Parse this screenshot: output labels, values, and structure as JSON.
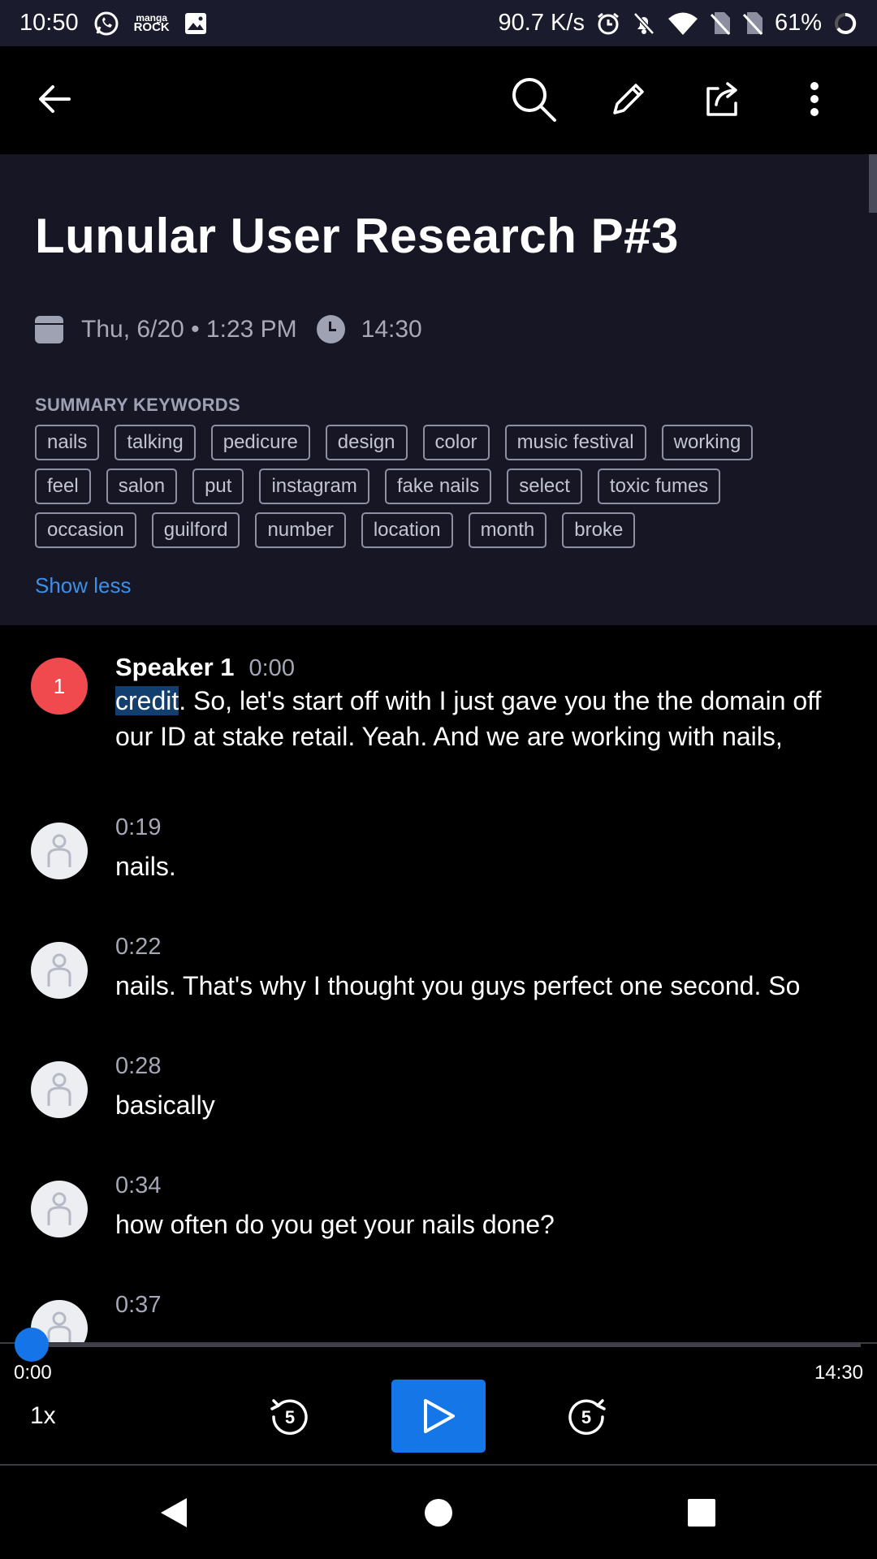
{
  "status_bar": {
    "time": "10:50",
    "app_label_top": "manga",
    "app_label_bottom": "ROCK",
    "net_speed": "90.7 K/s",
    "battery": "61%",
    "icons": [
      "whatsapp-icon",
      "manga-rock-icon",
      "image-icon",
      "alarm-icon",
      "bell-off-icon",
      "wifi-icon",
      "no-sim-icon",
      "no-sim-icon",
      "battery-icon"
    ]
  },
  "app_bar": {
    "icons": [
      "back-arrow-icon",
      "search-icon",
      "edit-pencil-icon",
      "share-icon",
      "more-vert-icon"
    ]
  },
  "header": {
    "title": "Lunular User Research P#3",
    "date": "Thu, 6/20 • 1:23 PM",
    "duration": "14:30",
    "keywords_label": "SUMMARY KEYWORDS",
    "keyword_rows": [
      [
        "nails",
        "talking",
        "pedicure",
        "design",
        "color",
        "music festival",
        "working"
      ],
      [
        "feel",
        "salon",
        "put",
        "instagram",
        "fake nails",
        "select",
        "toxic fumes"
      ],
      [
        "occasion",
        "guilford",
        "number",
        "location",
        "month",
        "broke"
      ]
    ],
    "show_less": "Show less"
  },
  "transcript": {
    "first": {
      "speaker_badge": "1",
      "speaker": "Speaker 1",
      "time": "0:00",
      "highlighted_word": "credit",
      "text_rest": ". So, let's start off with I just gave you the the domain off our ID at stake retail. Yeah. And we are working with nails,"
    },
    "entries": [
      {
        "time": "0:19",
        "text": "nails."
      },
      {
        "time": "0:22",
        "text": "nails. That's why I thought you guys perfect one second. So"
      },
      {
        "time": "0:28",
        "text": "basically"
      },
      {
        "time": "0:34",
        "text": "how often do you get your nails done?"
      },
      {
        "time": "0:37",
        "text": ""
      }
    ]
  },
  "player": {
    "current": "0:00",
    "total": "14:30",
    "progress": 0,
    "speed": "1x",
    "rewind_seconds": "5",
    "forward_seconds": "5"
  },
  "colors": {
    "accent": "#1576e8",
    "speaker_badge": "#f04a4e",
    "header_bg": "#161625",
    "link": "#3d8fe8"
  }
}
